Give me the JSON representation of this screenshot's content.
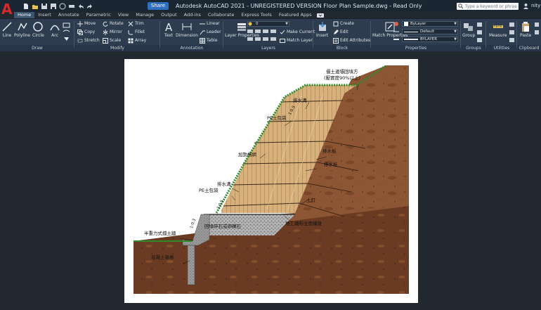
{
  "app": {
    "logo_letter": "A",
    "share_label": "Share",
    "window_title": "Autodesk AutoCAD 2021 - UNREGISTERED VERSION    Floor Plan Sample.dwg - Read Only",
    "search_placeholder": "Type a keyword or phrase",
    "user_name": "nity"
  },
  "quick_access_icons": [
    "new-file-icon",
    "open-file-icon",
    "save-icon",
    "save-as-icon",
    "web-icon",
    "plot-icon",
    "undo-icon",
    "redo-icon"
  ],
  "tabs": [
    {
      "label": "Home",
      "active": true
    },
    {
      "label": "Insert"
    },
    {
      "label": "Annotate"
    },
    {
      "label": "Parametric"
    },
    {
      "label": "View"
    },
    {
      "label": "Manage"
    },
    {
      "label": "Output"
    },
    {
      "label": "Add-ins"
    },
    {
      "label": "Collaborate"
    },
    {
      "label": "Express Tools"
    },
    {
      "label": "Featured Apps"
    }
  ],
  "ribbon": {
    "draw": {
      "label": "Draw",
      "line": "Line",
      "polyline": "Polyline",
      "circle": "Circle",
      "arc": "Arc"
    },
    "modify": {
      "label": "Modify",
      "move": "Move",
      "rotate": "Rotate",
      "trim": "Trim",
      "copy": "Copy",
      "mirror": "Mirror",
      "fillet": "Fillet",
      "stretch": "Stretch",
      "scale": "Scale",
      "array": "Array"
    },
    "annotation": {
      "label": "Annotation",
      "text": "Text",
      "dimension": "Dimension",
      "linear": "Linear",
      "leader": "Leader",
      "table": "Table"
    },
    "layers": {
      "label": "Layers",
      "layer_properties": "Layer Properties",
      "layer_value": "0",
      "make_current": "Make Current",
      "match_layer": "Match Layer"
    },
    "block": {
      "label": "Block",
      "insert": "Insert",
      "create": "Create",
      "edit": "Edit",
      "edit_attributes": "Edit Attributes"
    },
    "properties": {
      "label": "Properties",
      "match_properties": "Match Properties",
      "color_value": "ByLayer",
      "linetype_value": "Default",
      "lineweight_value": "BYLAYER"
    },
    "groups": {
      "label": "Groups",
      "group": "Group"
    },
    "utilities": {
      "label": "Utilities",
      "measure": "Measure"
    },
    "clipboard": {
      "label": "Clipboard",
      "paste": "Paste"
    }
  },
  "drawing": {
    "callouts": {
      "top_fill_1": "僵土邊壩回填方",
      "top_fill_2": "(壓實度90%以上)",
      "drain_ditch_top": "排水溝",
      "pe_bag_top": "PE土包袋",
      "reinforcement_net": "加勁格網",
      "drain_board_1": "排水板",
      "drain_board_2": "排水板",
      "drain_ditch_bottom": "排水溝",
      "pe_bag_bottom": "PE土包袋",
      "soil_nail": "土釘",
      "geotextile": "地工織布全面鋪設",
      "gravel_backfill": "回填碎石或卵礫石",
      "retaining_wall": "半重力式擋土牆",
      "concrete_pile": "混凝土基樁"
    },
    "slope_ratios": {
      "upper": "1:0.5",
      "lower": "1:0.5",
      "wall": "1:0.3"
    }
  },
  "colors": {
    "titlebar": "#1b2633",
    "ribbon": "#2d3c4e",
    "workspace": "#212830",
    "accent": "#2e6fbf",
    "soil": "#7a4628",
    "dark_soil": "#5e341d",
    "fill_layers": "#d7b17e",
    "grass": "#2f8a2a",
    "gravel": "#9a9a9a",
    "concrete": "#8c8c8c"
  }
}
